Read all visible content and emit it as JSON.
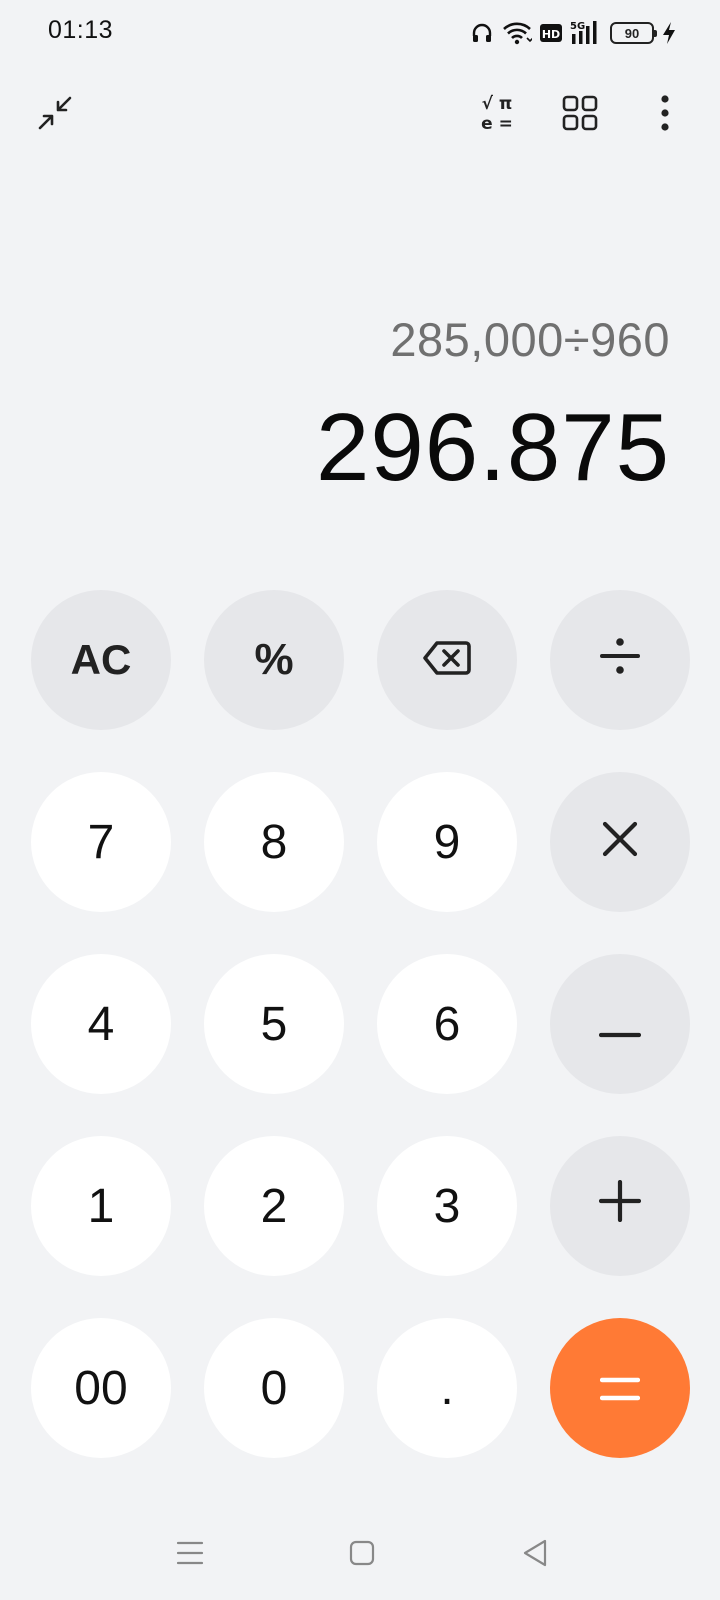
{
  "status_bar": {
    "time": "01:13",
    "network": "5G",
    "hd": "HD",
    "battery": "90",
    "icons": [
      "headphones-icon",
      "wifi-icon",
      "hd-icon",
      "signal-icon",
      "battery-icon",
      "charging-icon"
    ]
  },
  "toolbar": {
    "icons": [
      "collapse-icon",
      "scientific-icon",
      "converter-icon",
      "more-icon"
    ],
    "scientific_top": "√ π",
    "scientific_bottom": "e ="
  },
  "display": {
    "expression": "285,000÷960",
    "result": "296.875"
  },
  "keypad": {
    "row1": {
      "ac": "AC",
      "percent": "%",
      "backspace": "backspace-icon",
      "divide": "÷"
    },
    "row2": {
      "k7": "7",
      "k8": "8",
      "k9": "9",
      "multiply": "×"
    },
    "row3": {
      "k4": "4",
      "k5": "5",
      "k6": "6",
      "minus": "−"
    },
    "row4": {
      "k1": "1",
      "k2": "2",
      "k3": "3",
      "plus": "+"
    },
    "row5": {
      "k00": "00",
      "k0": "0",
      "dot": ".",
      "equals": "="
    }
  },
  "colors": {
    "background": "#f2f3f5",
    "key_light": "#ffffff",
    "key_gray": "#e6e7ea",
    "accent": "#ff7a35",
    "expression_text": "#707070"
  },
  "navbar": {
    "icons": [
      "menu-icon",
      "home-icon",
      "back-icon"
    ]
  }
}
